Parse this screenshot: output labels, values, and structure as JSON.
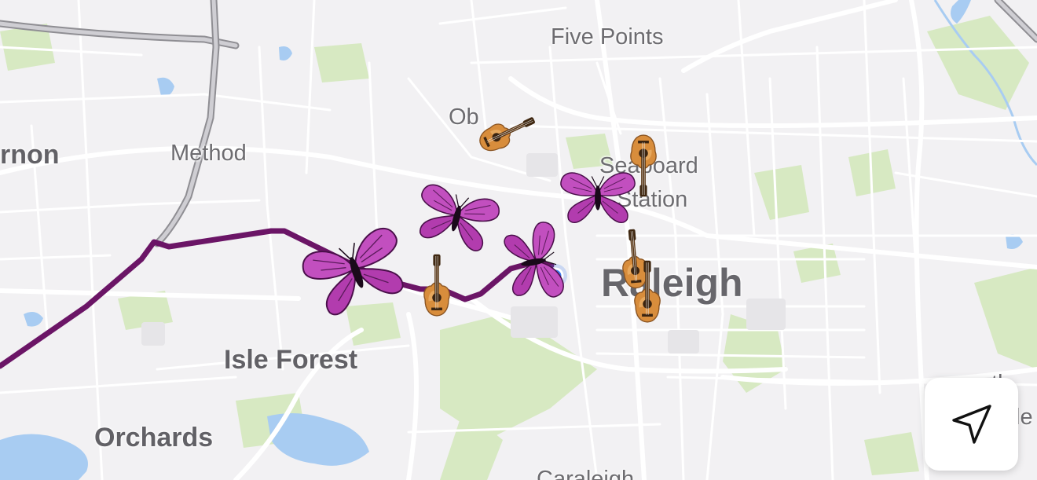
{
  "map": {
    "labels": {
      "five_points": "Five Points",
      "vernon": "rnon",
      "method": "Method",
      "oberlin": "Ob",
      "seaboard": "Seaboard",
      "station": "Station",
      "raleigh": "Raleigh",
      "isle_forest": "Isle Forest",
      "orchards": "Orchards",
      "caraleigh": "Caraleigh",
      "south_a": "th",
      "south_b": "le"
    },
    "route_color": "#6b1566",
    "markers": {
      "guitar_icon": "guitar-emoji",
      "butterfly_icon": "butterfly-emoji",
      "butterfly_color": "#c24fbf",
      "guitar_color": "#d98b3a"
    },
    "user_location_color": "#3c7bf0",
    "locate_button_icon": "navigation-arrow-icon"
  }
}
